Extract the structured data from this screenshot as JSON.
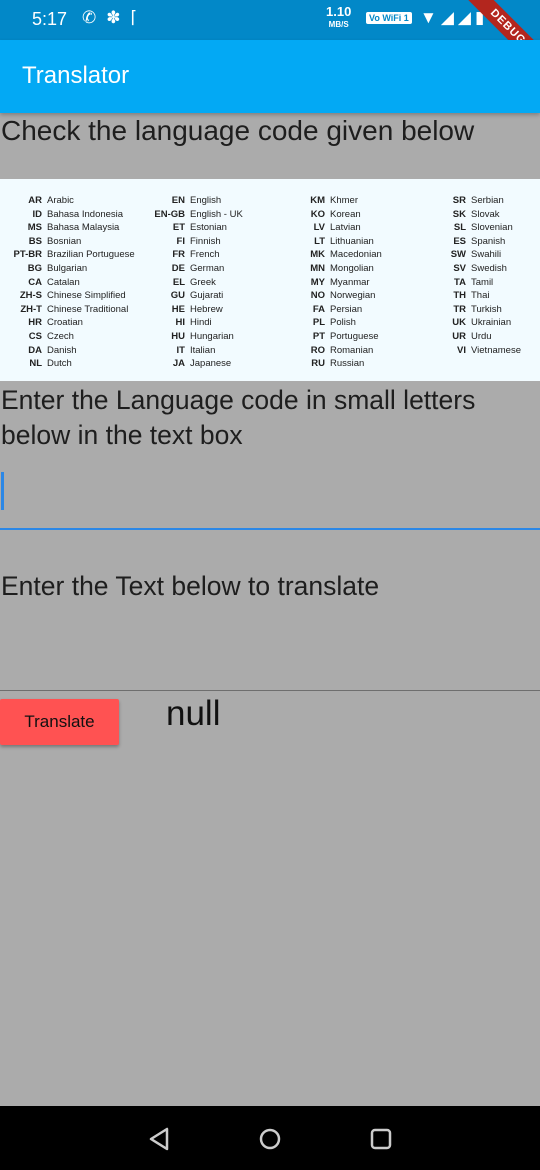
{
  "status_bar": {
    "time": "5:17",
    "speed_value": "1.10",
    "speed_unit": "MB/S",
    "wifi_badge": "Vo WiFi 1"
  },
  "debug_banner": "DEBUG",
  "app_bar": {
    "title": "Translator"
  },
  "heading_check": "Check the language code given below",
  "language_table": {
    "columns": [
      [
        {
          "code": "AR",
          "name": "Arabic"
        },
        {
          "code": "ID",
          "name": "Bahasa Indonesia"
        },
        {
          "code": "MS",
          "name": "Bahasa Malaysia"
        },
        {
          "code": "BS",
          "name": "Bosnian"
        },
        {
          "code": "PT-BR",
          "name": "Brazilian Portuguese"
        },
        {
          "code": "BG",
          "name": "Bulgarian"
        },
        {
          "code": "CA",
          "name": "Catalan"
        },
        {
          "code": "ZH-S",
          "name": "Chinese Simplified"
        },
        {
          "code": "ZH-T",
          "name": "Chinese Traditional"
        },
        {
          "code": "HR",
          "name": "Croatian"
        },
        {
          "code": "CS",
          "name": "Czech"
        },
        {
          "code": "DA",
          "name": "Danish"
        },
        {
          "code": "NL",
          "name": "Dutch"
        }
      ],
      [
        {
          "code": "EN",
          "name": "English"
        },
        {
          "code": "EN-GB",
          "name": "English - UK"
        },
        {
          "code": "ET",
          "name": "Estonian"
        },
        {
          "code": "FI",
          "name": "Finnish"
        },
        {
          "code": "FR",
          "name": "French"
        },
        {
          "code": "DE",
          "name": "German"
        },
        {
          "code": "EL",
          "name": "Greek"
        },
        {
          "code": "GU",
          "name": "Gujarati"
        },
        {
          "code": "HE",
          "name": "Hebrew"
        },
        {
          "code": "HI",
          "name": "Hindi"
        },
        {
          "code": "HU",
          "name": "Hungarian"
        },
        {
          "code": "IT",
          "name": "Italian"
        },
        {
          "code": "JA",
          "name": "Japanese"
        }
      ],
      [
        {
          "code": "KM",
          "name": "Khmer"
        },
        {
          "code": "KO",
          "name": "Korean"
        },
        {
          "code": "LV",
          "name": "Latvian"
        },
        {
          "code": "LT",
          "name": "Lithuanian"
        },
        {
          "code": "MK",
          "name": "Macedonian"
        },
        {
          "code": "MN",
          "name": "Mongolian"
        },
        {
          "code": "MY",
          "name": "Myanmar"
        },
        {
          "code": "NO",
          "name": "Norwegian"
        },
        {
          "code": "FA",
          "name": "Persian"
        },
        {
          "code": "PL",
          "name": "Polish"
        },
        {
          "code": "PT",
          "name": "Portuguese"
        },
        {
          "code": "RO",
          "name": "Romanian"
        },
        {
          "code": "RU",
          "name": "Russian"
        }
      ],
      [
        {
          "code": "SR",
          "name": "Serbian"
        },
        {
          "code": "SK",
          "name": "Slovak"
        },
        {
          "code": "SL",
          "name": "Slovenian"
        },
        {
          "code": "ES",
          "name": "Spanish"
        },
        {
          "code": "SW",
          "name": "Swahili"
        },
        {
          "code": "SV",
          "name": "Swedish"
        },
        {
          "code": "TA",
          "name": "Tamil"
        },
        {
          "code": "TH",
          "name": "Thai"
        },
        {
          "code": "TR",
          "name": "Turkish"
        },
        {
          "code": "UK",
          "name": "Ukrainian"
        },
        {
          "code": "UR",
          "name": "Urdu"
        },
        {
          "code": "VI",
          "name": "Vietnamese"
        }
      ]
    ]
  },
  "heading_code": "Enter the Language code in small letters below in the text box",
  "code_input": {
    "value": "",
    "placeholder": ""
  },
  "heading_text": "Enter the Text below to translate",
  "text_input": {
    "value": "",
    "placeholder": ""
  },
  "translate_button": "Translate",
  "result_text": "null",
  "colors": {
    "status_bar": "#0288c8",
    "app_bar": "#03a9f4",
    "background": "#ababab",
    "translate_button": "#ff5252",
    "input_focus": "#2b87e6"
  }
}
